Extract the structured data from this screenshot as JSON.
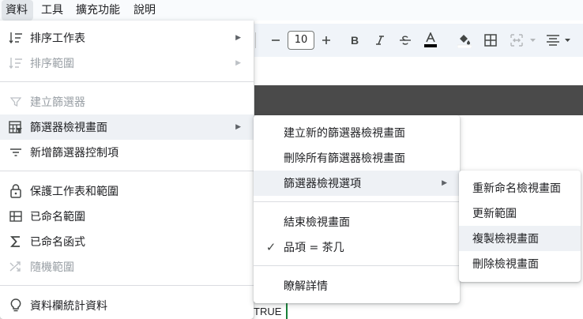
{
  "menubar": {
    "items": [
      {
        "label": "資料"
      },
      {
        "label": "工具"
      },
      {
        "label": "擴充功能"
      },
      {
        "label": "說明"
      }
    ]
  },
  "toolbar": {
    "font_size": "10"
  },
  "cell": {
    "value": "TRUE"
  },
  "data_menu": {
    "items": [
      {
        "label": "排序工作表",
        "icon": "sort-icon",
        "submenu": "▶"
      },
      {
        "label": "排序範圍",
        "icon": "sort-range-icon",
        "submenu": "▶"
      },
      {
        "label": "建立篩選器",
        "icon": "filter-icon"
      },
      {
        "label": "篩選器檢視畫面",
        "icon": "filter-views-icon",
        "submenu": "▶"
      },
      {
        "label": "新增篩選器控制項",
        "icon": "slicer-icon"
      },
      {
        "label": "保護工作表和範圍",
        "icon": "lock-icon"
      },
      {
        "label": "已命名範圍",
        "icon": "named-ranges-icon"
      },
      {
        "label": "已命名函式",
        "icon": "sigma-icon"
      },
      {
        "label": "隨機範圍",
        "icon": "shuffle-icon"
      },
      {
        "label": "資料欄統計資料",
        "icon": "lightbulb-icon"
      }
    ]
  },
  "filter_views_menu": {
    "items": [
      {
        "label": "建立新的篩選器檢視畫面"
      },
      {
        "label": "刪除所有篩選器檢視畫面"
      },
      {
        "label": "篩選器檢視選項",
        "submenu": "▶"
      },
      {
        "label": "結束檢視畫面"
      },
      {
        "label": "品項 = 茶几",
        "check": "✓"
      },
      {
        "label": "瞭解詳情"
      }
    ]
  },
  "filter_view_options_menu": {
    "items": [
      {
        "label": "重新命名檢視畫面"
      },
      {
        "label": "更新範圍"
      },
      {
        "label": "複製檢視畫面"
      },
      {
        "label": "刪除檢視畫面"
      }
    ]
  }
}
